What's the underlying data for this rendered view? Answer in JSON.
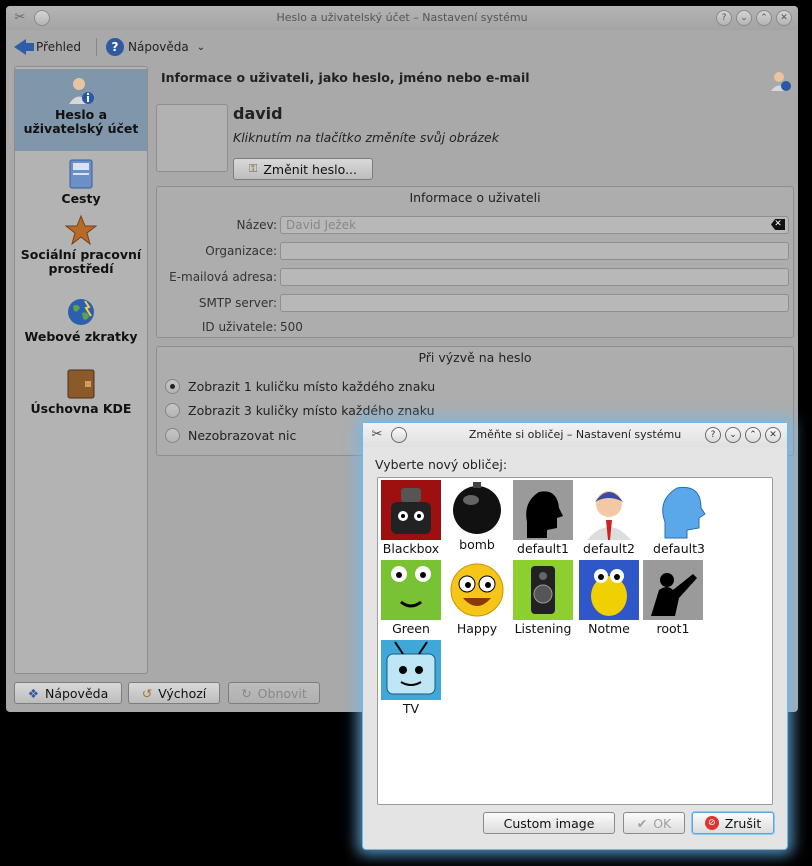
{
  "main_window": {
    "title": "Heslo a uživatelský účet – Nastavení systému",
    "toolbar": {
      "overview_label": "Přehled",
      "help_label": "Nápověda"
    },
    "sidebar": {
      "items": [
        {
          "label": "Heslo a uživatelský účet",
          "icon": "user-info-icon",
          "active": true
        },
        {
          "label": "Cesty",
          "icon": "paths-icon"
        },
        {
          "label": "Sociální pracovní prostředí",
          "icon": "star-icon"
        },
        {
          "label": "Webové zkratky",
          "icon": "globe-icon"
        },
        {
          "label": "Úschovna KDE",
          "icon": "wallet-icon"
        }
      ]
    },
    "page_title": "Informace o uživateli, jako heslo, jméno nebo e-mail",
    "username": "david",
    "avatar_hint": "Kliknutím na tlačítko změníte svůj obrázek",
    "change_password_label": "Změnit heslo...",
    "user_info": {
      "title": "Informace o uživateli",
      "name_label": "Název:",
      "name_placeholder": "David Ježek",
      "org_label": "Organizace:",
      "email_label": "E-mailová adresa:",
      "smtp_label": "SMTP server:",
      "uid_label": "ID uživatele:",
      "uid_value": "500"
    },
    "password_prompt": {
      "title": "Při výzvě na heslo",
      "options": [
        {
          "label": "Zobrazit 1 kuličku místo každého znaku",
          "checked": true
        },
        {
          "label": "Zobrazit 3 kuličky místo každého znaku",
          "checked": false
        },
        {
          "label": "Nezobrazovat nic",
          "checked": false
        }
      ]
    },
    "bottom_buttons": {
      "help": "Nápověda",
      "defaults": "Výchozí",
      "reset": "Obnovit"
    }
  },
  "dialog": {
    "title": "Změňte si obličej – Nastavení systému",
    "prompt": "Vyberte nový obličej:",
    "faces": [
      "Blackbox",
      "bomb",
      "default1",
      "default2",
      "default3",
      "Green",
      "Happy",
      "Listening",
      "Notme",
      "root1",
      "TV"
    ],
    "buttons": {
      "custom": "Custom image",
      "ok": "OK",
      "cancel": "Zrušit"
    }
  }
}
